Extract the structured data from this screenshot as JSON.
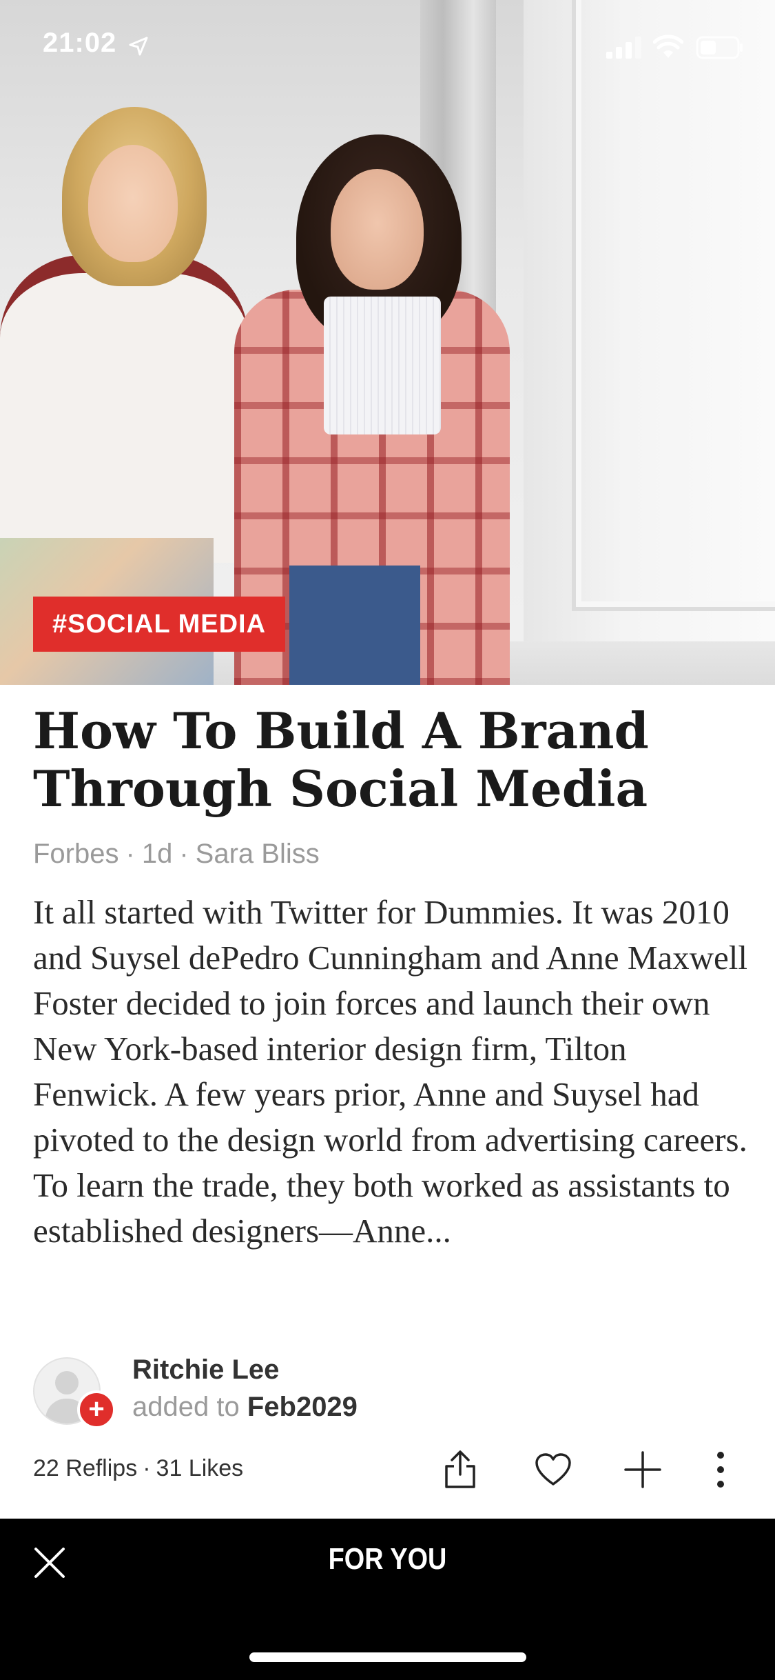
{
  "status_bar": {
    "time": "21:02"
  },
  "article": {
    "tag": "#SOCIAL MEDIA",
    "title": "How To Build A Brand Through Social Media",
    "source": "Forbes",
    "age": "1d",
    "author": "Sara Bliss",
    "excerpt": "It all started with Twitter for Dummies. It was 2010 and Suysel dePedro Cunningham and Anne Maxwell Foster decided to join forces and launch their own New York-based interior design firm, Tilton Fenwick. A few years prior, Anne and Suysel had pivoted to the design world from advertising careers. To learn the trade, they both worked as assistants to established designers—Anne..."
  },
  "curator": {
    "name": "Ritchie Lee",
    "added_to_label": "added to",
    "magazine": "Feb2029"
  },
  "stats": {
    "reflips": "22 Reflips",
    "likes": "31 Likes"
  },
  "bottom_bar": {
    "section_label": "FOR YOU"
  },
  "colors": {
    "accent": "#e02e2b",
    "bottom_bar": "#000000"
  },
  "icons": [
    "location-arrow-icon",
    "signal-icon",
    "wifi-icon",
    "battery-icon",
    "share-icon",
    "heart-icon",
    "plus-icon",
    "more-vertical-icon",
    "close-icon"
  ]
}
